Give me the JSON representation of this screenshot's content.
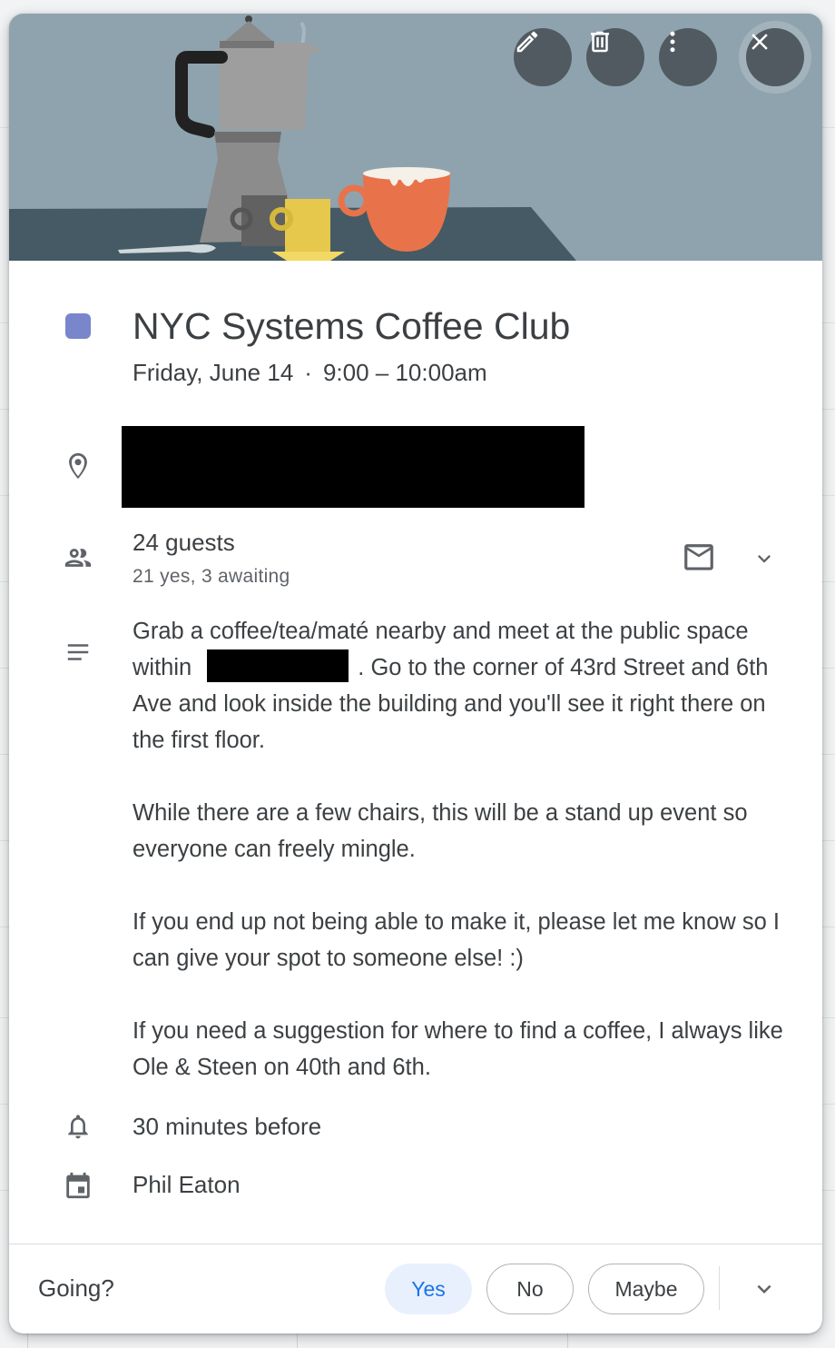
{
  "event": {
    "title": "NYC Systems Coffee Club",
    "date": "Friday, June 14",
    "separator": "·",
    "time": "9:00 – 10:00am",
    "color": "#7986cb"
  },
  "header": {
    "icons": [
      "edit-icon",
      "delete-icon",
      "more-options-icon",
      "close-icon"
    ]
  },
  "guests": {
    "count": "24 guests",
    "summary": "21 yes, 3 awaiting"
  },
  "description": {
    "p1a": "Grab a coffee/tea/maté nearby and meet at the public space within",
    "p1b": ". Go to the corner of 43rd Street and 6th Ave and look inside the building and you'll see it right there on the first floor.",
    "p2": "While there are a few chairs, this will be a stand up event so everyone can freely mingle.",
    "p3": "If you end up not being able to make it, please let me know so I can give your spot to someone else! :)",
    "p4": "If you need a suggestion for where to find a coffee, I always like Ole & Steen on 40th and 6th."
  },
  "reminder": "30 minutes before",
  "organizer": "Phil Eaton",
  "footer": {
    "prompt": "Going?",
    "yes": "Yes",
    "no": "No",
    "maybe": "Maybe"
  }
}
